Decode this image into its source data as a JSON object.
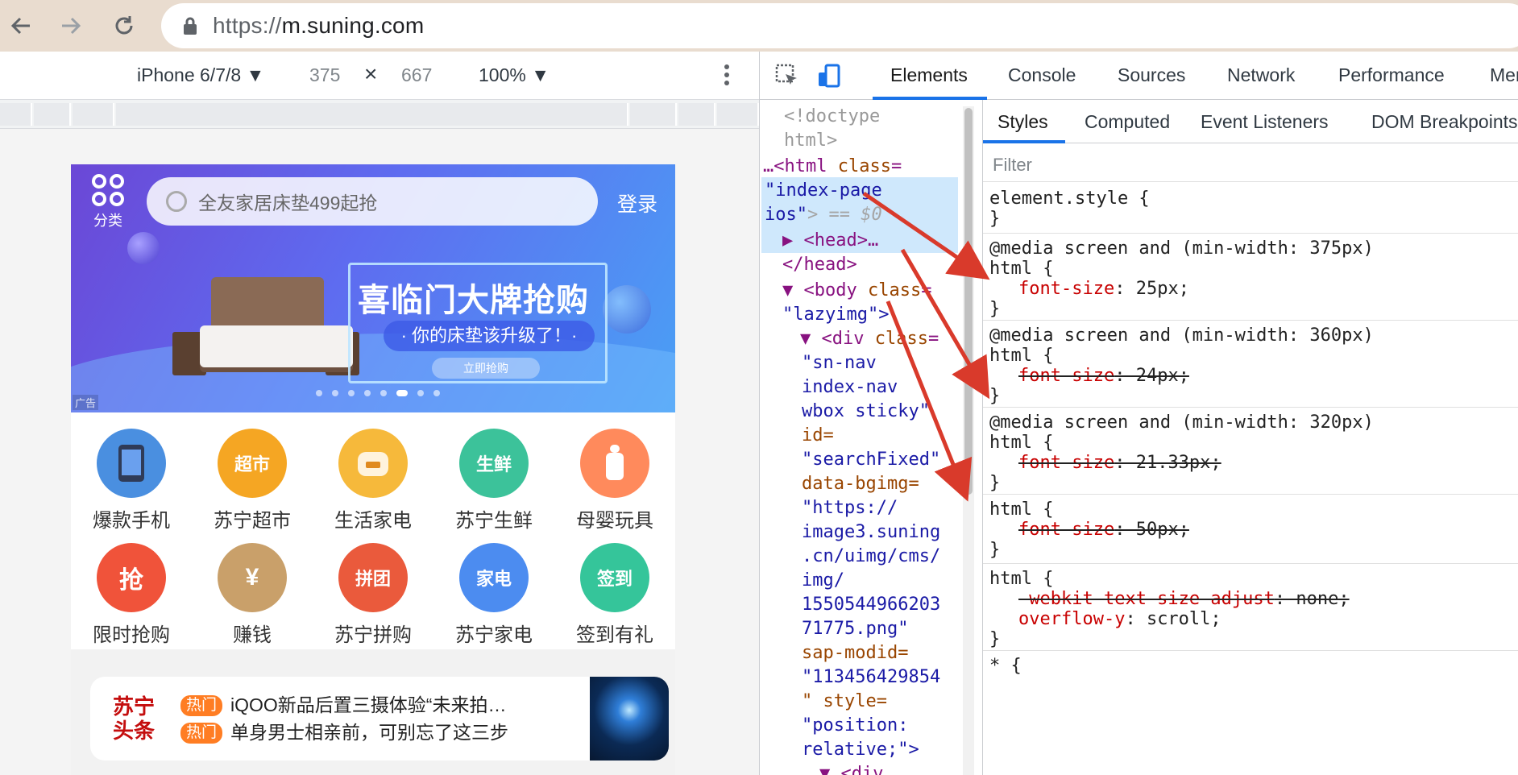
{
  "browser": {
    "url_scheme": "https://",
    "url_host": "m.suning.com"
  },
  "device_toolbar": {
    "device": "iPhone 6/7/8 ▼",
    "width": "375",
    "times": "×",
    "height": "667",
    "zoom": "100% ▼"
  },
  "page": {
    "category_label": "分类",
    "search_placeholder": "全友家居床垫499起抢",
    "login": "登录",
    "banner": {
      "title": "喜临门大牌抢购",
      "subtitle": "· 你的床垫该升级了！·",
      "button": "立即抢购",
      "ad_tag": "广告"
    },
    "grid": [
      {
        "label": "爆款手机",
        "icon": "phone-icon",
        "badge": "",
        "color": "#4a8fe0"
      },
      {
        "label": "苏宁超市",
        "icon": "basket-icon",
        "badge": "超市",
        "color": "#f5a623"
      },
      {
        "label": "生活家电",
        "icon": "rice-cooker-icon",
        "badge": "",
        "color": "#f6b93b"
      },
      {
        "label": "苏宁生鲜",
        "icon": "fresh-food-icon",
        "badge": "生鲜",
        "color": "#3cc29a"
      },
      {
        "label": "母婴玩具",
        "icon": "baby-bottle-icon",
        "badge": "",
        "color": "#ff8a5c"
      },
      {
        "label": "限时抢购",
        "icon": "flash-sale-icon",
        "badge": "抢",
        "color": "#f0533a"
      },
      {
        "label": "赚钱",
        "icon": "money-bag-icon",
        "badge": "¥",
        "color": "#c9a06a"
      },
      {
        "label": "苏宁拼购",
        "icon": "group-buy-icon",
        "badge": "拼团",
        "color": "#ea5a3c"
      },
      {
        "label": "苏宁家电",
        "icon": "washer-icon",
        "badge": "家电",
        "color": "#4c8cf0"
      },
      {
        "label": "签到有礼",
        "icon": "gift-icon",
        "badge": "签到",
        "color": "#35c59a"
      }
    ],
    "news": {
      "brand": "苏宁头条",
      "items": [
        {
          "tag": "热门",
          "text": "iQOO新品后置三摄体验“未来拍…"
        },
        {
          "tag": "热门",
          "text": "单身男士相亲前，可别忘了这三步"
        }
      ]
    }
  },
  "devtools": {
    "tabs": [
      "Elements",
      "Console",
      "Sources",
      "Network",
      "Performance",
      "Mem"
    ],
    "active_tab": "Elements",
    "dom_lines": {
      "l1": "<!doctype",
      "l2": "html>",
      "l3a": "…<html ",
      "l3b": "class",
      "l3c": "=",
      "l4": "\"index-page",
      "l5a": "ios\"",
      "l5b": "> == $0",
      "l6": "▶ <head>…",
      "l7": "</head>",
      "l8a": "▼ <body ",
      "l8b": "class",
      "l8c": "=",
      "l9": "\"lazyimg\">",
      "l10a": "▼ <div ",
      "l10b": "class",
      "l10c": "=",
      "l11": "\"sn-nav",
      "l12": "index-nav",
      "l13": "wbox sticky\"",
      "l14": "id=",
      "l15": "\"searchFixed\"",
      "l16": "data-bgimg=",
      "l17": "\"https://",
      "l18": "image3.suning",
      "l19": ".cn/uimg/cms/",
      "l20": "img/",
      "l21": "1550544966203",
      "l22": "71775.png\"",
      "l23": "sap-modid=",
      "l24": "\"113456429854",
      "l25": "\" style=",
      "l26": "\"position:",
      "l27": "relative;\">",
      "l28": "▼ <div"
    },
    "side_tabs": [
      "Styles",
      "Computed",
      "Event Listeners",
      "DOM Breakpoints"
    ],
    "filter_placeholder": "Filter",
    "styles": {
      "r0a": "element.style {",
      "r0b": "}",
      "r1a": "@media screen and (min-width: 375px)",
      "r1b": "html {",
      "r1p": "font-size",
      "r1v": ": 25px;",
      "r1c": "}",
      "r2a": "@media screen and (min-width: 360px)",
      "r2b": "html {",
      "r2p": "font-size",
      "r2v": ": 24px;",
      "r2c": "}",
      "r3a": "@media screen and (min-width: 320px)",
      "r3b": "html {",
      "r3p": "font-size",
      "r3v": ": 21.33px;",
      "r3c": "}",
      "r4a": "html {",
      "r4p": "font-size",
      "r4v": ": 50px;",
      "r4c": "}",
      "r5a": "html {",
      "r5p1": "-webkit-text-size-adjust",
      "r5v1": ": none;",
      "r5p2": "overflow-y",
      "r5v2": ": scroll;",
      "r5c": "}",
      "r6a": "* {"
    }
  },
  "colors": {
    "annotation_arrow": "#d93a2b",
    "accent_blue": "#1a73e8",
    "suning_red": "#c40e0e"
  }
}
